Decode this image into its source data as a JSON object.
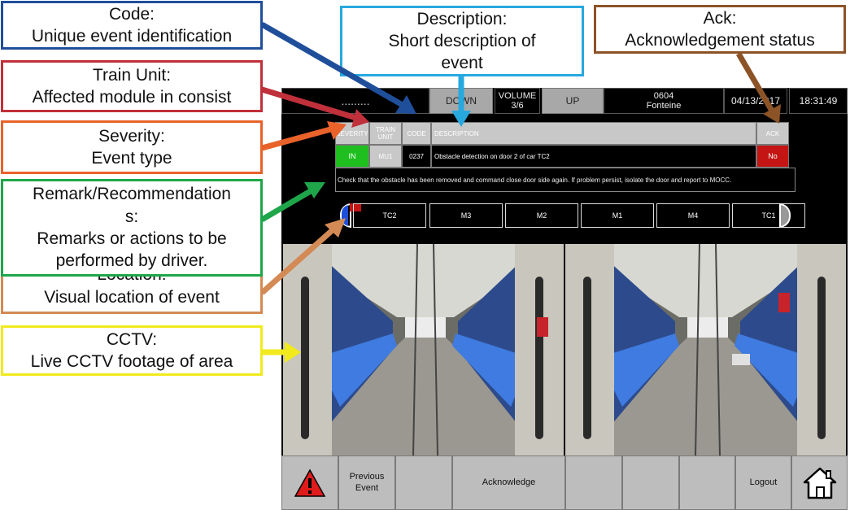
{
  "callouts": {
    "code": {
      "title": "Code:",
      "desc": "Unique event identification"
    },
    "train_unit": {
      "title": "Train Unit:",
      "desc": "Affected module in consist"
    },
    "severity": {
      "title": "Severity:",
      "desc": "Event type"
    },
    "remark": {
      "title": "Remark/Recommendation",
      "title2": "s:",
      "desc": "Remarks or actions to be performed by driver."
    },
    "location": {
      "title": "Location:",
      "desc": "Visual location of event"
    },
    "cctv": {
      "title": "CCTV:",
      "desc": "Live CCTV footage of area"
    },
    "description": {
      "title": "Description:",
      "desc": "Short description of event"
    },
    "ack": {
      "title": "Ack:",
      "desc": "Acknowledgement status"
    }
  },
  "topbar": {
    "dots": ".........",
    "down_label": "DOWN",
    "volume_label": "VOLUME",
    "volume_value": "3/6",
    "up_label": "UP",
    "train_number": "0604",
    "station": "Fonteine",
    "date": "04/13/2017",
    "time": "18:31:49"
  },
  "event_table": {
    "headers": [
      "SEVERITY",
      "TRAIN UNIT",
      "CODE",
      "DESCRIPTION",
      "ACK"
    ],
    "row": {
      "severity": "IN",
      "train_unit": "MU1",
      "code": "0237",
      "description": "Obstacle detection on door 2 of car TC2",
      "ack": "No"
    },
    "remark": "Check that the obstacle has been removed and command close door side again. If problem persist, isolate the door and report to MOCC."
  },
  "consist": {
    "cars": [
      "TC2",
      "M3",
      "M2",
      "M1",
      "M4",
      "TC1"
    ]
  },
  "bottombar": {
    "previous_event": "Previous Event",
    "acknowledge": "Acknowledge",
    "logout": "Logout"
  },
  "colors": {
    "code_border": "#1f4e9a",
    "train_unit_border": "#c0303a",
    "severity_border": "#e8622a",
    "remark_border": "#1fa64a",
    "location_border": "#d38a55",
    "cctv_border": "#f1ea1c",
    "description_border": "#27a9df",
    "ack_border": "#8c5327",
    "severity_in": "#1fbf1f",
    "ack_no": "#c41414"
  },
  "icons": {
    "warning": "warning-triangle-icon",
    "home": "home-icon"
  }
}
